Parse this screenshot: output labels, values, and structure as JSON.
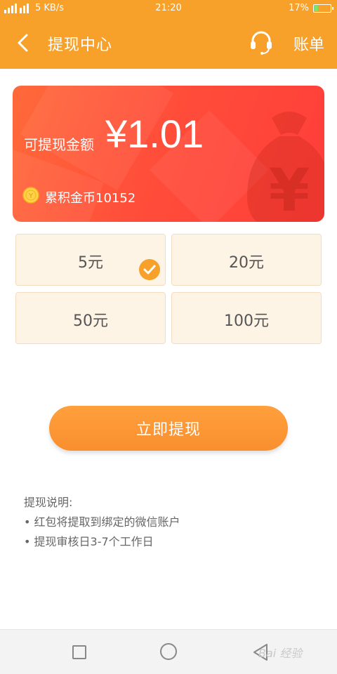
{
  "status_bar": {
    "network": "5 KB/s",
    "time": "21:20",
    "battery": "17%",
    "battery_level": 0.17
  },
  "header": {
    "title": "提现中心",
    "right_label": "账单",
    "bg_color": "#f7a12a"
  },
  "balance_card": {
    "label": "可提现金额",
    "amount": "¥1.01",
    "coins": "累积金币10152",
    "bg_color": "#ff4e3a"
  },
  "options": [
    {
      "label": "5元",
      "selected": true
    },
    {
      "label": "20元",
      "selected": false
    },
    {
      "label": "50元",
      "selected": false
    },
    {
      "label": "100元",
      "selected": false
    }
  ],
  "withdraw_button": "立即提现",
  "notes": {
    "title": "提现说明:",
    "items": [
      "• 红包将提取到绑定的微信账户",
      "• 提现审核日3-7个工作日"
    ]
  },
  "watermark": "Bai 经验",
  "icons": [
    "back-icon",
    "headset-icon",
    "coin-icon",
    "money-bag-icon",
    "check-icon",
    "nav-square-icon",
    "nav-circle-icon",
    "nav-back-icon"
  ]
}
